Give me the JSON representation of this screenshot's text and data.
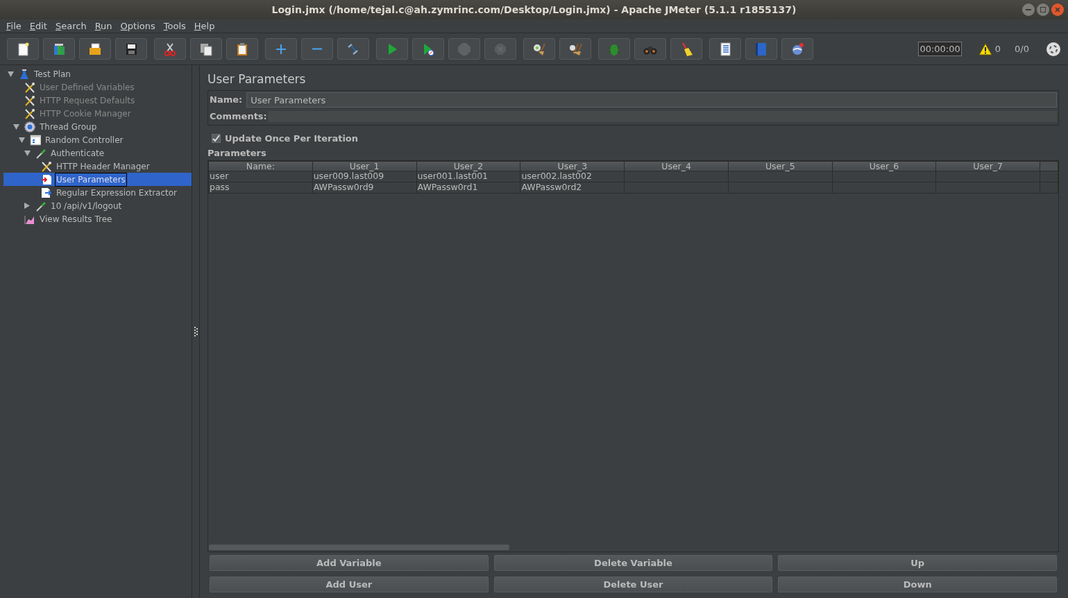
{
  "window": {
    "title": "Login.jmx (/home/tejal.c@ah.zymrinc.com/Desktop/Login.jmx) - Apache JMeter (5.1.1 r1855137)"
  },
  "menu": [
    "File",
    "Edit",
    "Search",
    "Run",
    "Options",
    "Tools",
    "Help"
  ],
  "toolbar": [
    [
      {
        "kind": "new",
        "disabled": false
      },
      {
        "kind": "templates",
        "disabled": false
      },
      {
        "kind": "open",
        "disabled": false
      },
      {
        "kind": "save",
        "disabled": false
      }
    ],
    [
      {
        "kind": "cut",
        "disabled": false
      },
      {
        "kind": "copy",
        "disabled": false
      },
      {
        "kind": "paste",
        "disabled": false
      }
    ],
    [
      {
        "kind": "expand",
        "disabled": false
      },
      {
        "kind": "collapse",
        "disabled": false
      },
      {
        "kind": "toggle",
        "disabled": false
      }
    ],
    [
      {
        "kind": "start",
        "disabled": false
      },
      {
        "kind": "start-no-pause",
        "disabled": false
      },
      {
        "kind": "stop",
        "disabled": true
      },
      {
        "kind": "shutdown",
        "disabled": true
      }
    ],
    [
      {
        "kind": "clear",
        "disabled": false
      },
      {
        "kind": "clear-all",
        "disabled": false
      }
    ],
    [
      {
        "kind": "function",
        "disabled": false
      },
      {
        "kind": "search",
        "disabled": false
      },
      {
        "kind": "reset-search",
        "disabled": false
      }
    ],
    [
      {
        "kind": "log",
        "disabled": false
      },
      {
        "kind": "help",
        "disabled": false
      },
      {
        "kind": "remote",
        "disabled": false
      }
    ]
  ],
  "status": {
    "timer": "00:00:00",
    "warnings": "0",
    "threads": "0/0"
  },
  "tree": [
    {
      "label": "Test Plan",
      "kind": "test-plan",
      "expanded": true,
      "disabled": false,
      "selected": false,
      "children": [
        {
          "label": "User Defined Variables",
          "kind": "config",
          "disabled": true,
          "selected": false
        },
        {
          "label": "HTTP Request Defaults",
          "kind": "config",
          "disabled": true,
          "selected": false
        },
        {
          "label": "HTTP Cookie Manager",
          "kind": "config",
          "disabled": true,
          "selected": false
        },
        {
          "label": "Thread Group",
          "kind": "thread-group",
          "expanded": true,
          "disabled": false,
          "selected": false,
          "children": [
            {
              "label": "Random Controller",
              "kind": "controller",
              "expanded": true,
              "disabled": false,
              "selected": false,
              "children": [
                {
                  "label": "Authenticate",
                  "kind": "sampler",
                  "expanded": true,
                  "disabled": false,
                  "selected": false,
                  "children": [
                    {
                      "label": "HTTP Header Manager",
                      "kind": "config",
                      "disabled": false,
                      "selected": false
                    },
                    {
                      "label": "User Parameters",
                      "kind": "preprocessor",
                      "disabled": false,
                      "selected": true
                    },
                    {
                      "label": "Regular Expression Extractor",
                      "kind": "postprocessor",
                      "disabled": false,
                      "selected": false
                    }
                  ]
                },
                {
                  "label": "10 /api/v1/logout",
                  "kind": "sampler",
                  "expanded": false,
                  "disabled": false,
                  "selected": false
                }
              ]
            }
          ]
        },
        {
          "label": "View Results Tree",
          "kind": "listener",
          "disabled": false,
          "selected": false
        }
      ]
    }
  ],
  "panel": {
    "title": "User Parameters",
    "name_label": "Name:",
    "name_value": "User Parameters",
    "comments_label": "Comments:",
    "update_once": {
      "label": "Update Once Per Iteration",
      "checked": true
    },
    "parameters_label": "Parameters",
    "table": {
      "columns": [
        "Name:",
        "User_1",
        "User_2",
        "User_3",
        "User_4",
        "User_5",
        "User_6",
        "User_7"
      ],
      "rows": [
        {
          "name": "user",
          "values": [
            "user009.last009",
            "user001.last001",
            "user002.last002"
          ]
        },
        {
          "name": "pass",
          "values": [
            "AWPassw0rd9",
            "AWPassw0rd1",
            "AWPassw0rd2"
          ]
        }
      ]
    },
    "buttons": [
      "Add Variable",
      "Delete Variable",
      "Up",
      "Add User",
      "Delete User",
      "Down"
    ]
  }
}
